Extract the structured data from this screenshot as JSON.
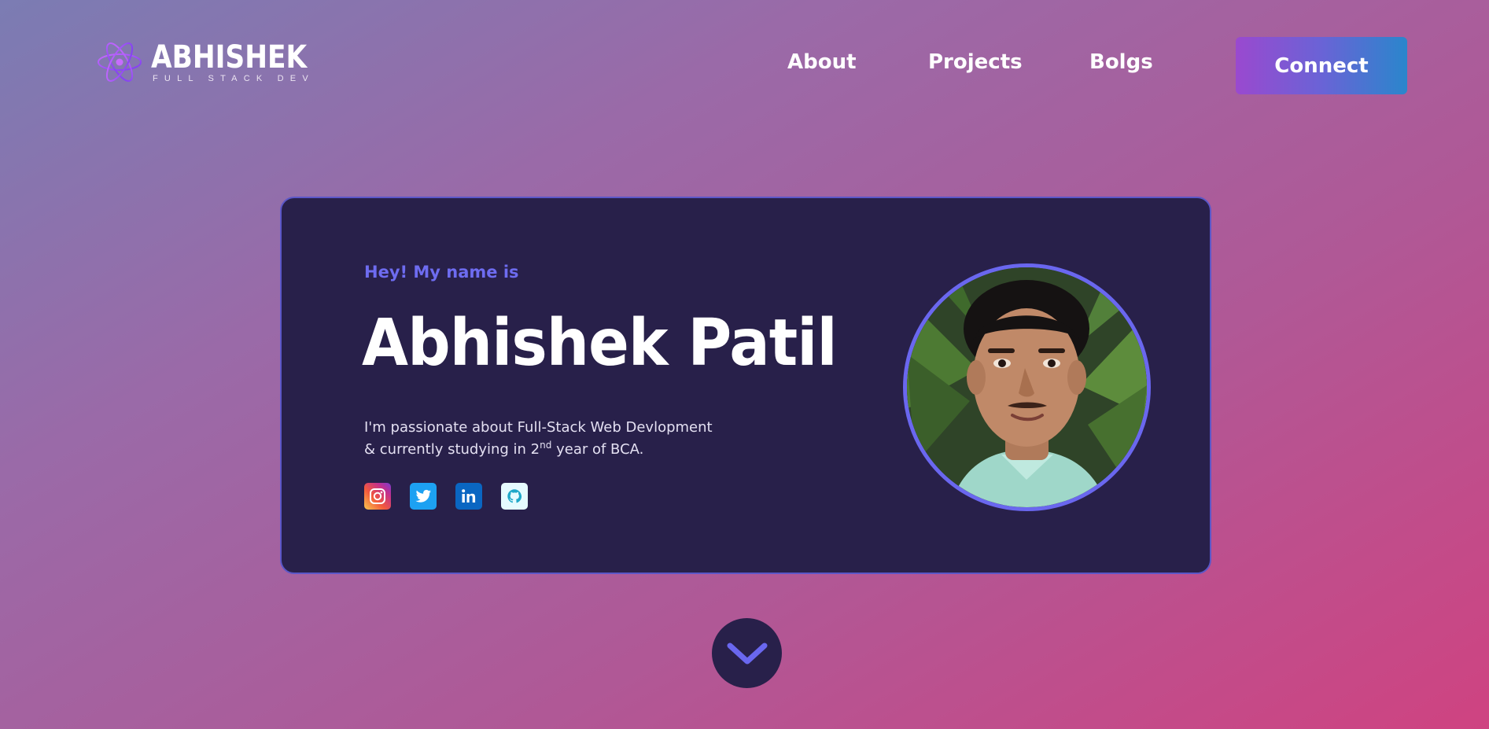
{
  "brand": {
    "name": "ABHISHEK",
    "tagline": "FULL STACK DEV",
    "logo_icon": "atom-icon"
  },
  "nav": {
    "links": [
      {
        "label": "About"
      },
      {
        "label": "Projects"
      },
      {
        "label": "Bolgs"
      }
    ],
    "cta_label": "Connect"
  },
  "hero": {
    "greeting": "Hey! My name is",
    "name": "Abhishek Patil",
    "bio_line1": "I'm passionate about Full-Stack Web Devlopment",
    "bio_line2_prefix": "& currently studying in 2",
    "bio_line2_sup": "nd",
    "bio_line2_suffix": " year of BCA.",
    "socials": [
      {
        "name": "instagram",
        "icon": "instagram-icon"
      },
      {
        "name": "twitter",
        "icon": "twitter-icon"
      },
      {
        "name": "linkedin",
        "icon": "linkedin-icon"
      },
      {
        "name": "github",
        "icon": "github-icon"
      }
    ],
    "avatar": "profile-photo"
  },
  "scroll": {
    "icon": "chevron-down-icon"
  },
  "colors": {
    "card_bg": "#28204a",
    "accent": "#6a67ef",
    "cta_gradient_start": "#9a49cf",
    "cta_gradient_end": "#2a86cc"
  }
}
